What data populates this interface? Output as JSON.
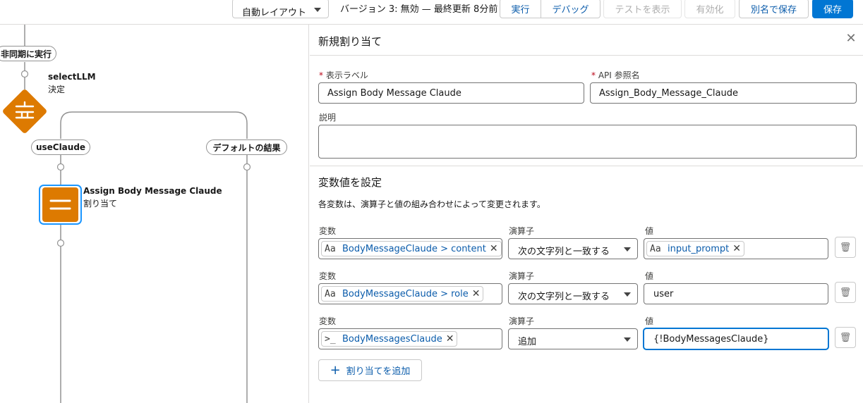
{
  "toolbar": {
    "layout_value": "自動レイアウト",
    "version_text": "バージョン 3: 無効 — 最終更新 8分前",
    "run_label": "実行",
    "debug_label": "デバッグ",
    "test_label": "テストを表示",
    "activate_label": "有効化",
    "save_as_label": "別名で保存",
    "save_label": "保存"
  },
  "canvas": {
    "async_label": "非同期に実行",
    "decision_title": "selectLLM",
    "decision_sub": "決定",
    "branch1_label": "useClaude",
    "branch2_label": "デフォルトの結果",
    "assign_title": "Assign Body Message Claude",
    "assign_sub": "割り当て"
  },
  "panel": {
    "title": "新規割り当て",
    "label_field_label": "表示ラベル",
    "label_field_value": "Assign Body Message Claude",
    "api_field_label": "API 参照名",
    "api_field_value": "Assign_Body_Message_Claude",
    "description_label": "説明",
    "description_value": "",
    "section_title": "変数値を設定",
    "section_desc": "各変数は、演算子と値の組み合わせによって変更されます。",
    "col_variable": "変数",
    "col_operator": "演算子",
    "col_value": "値",
    "add_button_label": "割り当てを追加",
    "rows": [
      {
        "variable": "BodyMessageClaude > content",
        "variable_icon": "text-type-icon",
        "operator": "次の文字列と一致する",
        "value": "input_prompt",
        "value_is_chip": true
      },
      {
        "variable": "BodyMessageClaude > role",
        "variable_icon": "text-type-icon",
        "operator": "次の文字列と一致する",
        "value": "user",
        "value_is_chip": false
      },
      {
        "variable": "BodyMessagesClaude",
        "variable_icon": "collection-type-icon",
        "operator": "追加",
        "value": "{!BodyMessagesClaude}",
        "value_is_chip": false
      }
    ]
  },
  "colors": {
    "brand": "#0176d3",
    "decision_orange": "#dd7a01",
    "assignment_orange": "#dd7a01"
  }
}
